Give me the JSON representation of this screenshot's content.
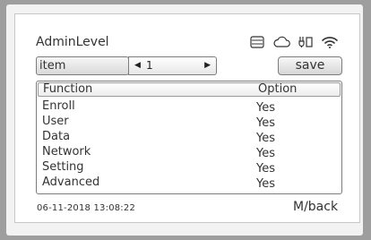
{
  "header": {
    "title": "AdminLevel",
    "status_icons": [
      "card-icon",
      "cloud-icon",
      "plug-icon",
      "wifi-icon"
    ]
  },
  "toolbar": {
    "item_label": "item",
    "stepper_value": "1",
    "save_label": "save"
  },
  "table": {
    "columns": [
      "Function",
      "Option"
    ],
    "rows": [
      [
        "Enroll",
        "Yes"
      ],
      [
        "User",
        "Yes"
      ],
      [
        "Data",
        "Yes"
      ],
      [
        "Network",
        "Yes"
      ],
      [
        "Setting",
        "Yes"
      ],
      [
        "Advanced",
        "Yes"
      ]
    ]
  },
  "footer": {
    "datetime": "06-11-2018  13:08:22",
    "back_label": "M/back"
  }
}
